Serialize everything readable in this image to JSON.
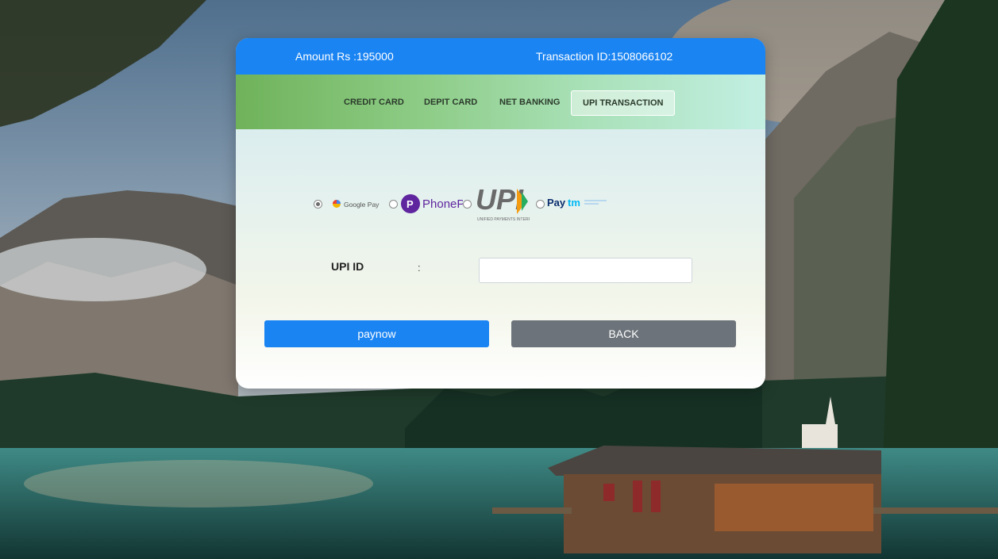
{
  "header": {
    "amount": "Amount Rs :195000",
    "transaction": "Transaction ID:1508066102"
  },
  "tabs": [
    {
      "label": "CREDIT CARD",
      "active": false
    },
    {
      "label": "DEPIT CARD",
      "active": false
    },
    {
      "label": "NET BANKING",
      "active": false
    },
    {
      "label": "UPI TRANSACTION",
      "active": true
    }
  ],
  "payment_options": [
    {
      "name": "Google Pay",
      "icon": "google-pay-logo",
      "selected": true
    },
    {
      "name": "PhonePe",
      "icon": "phonepe-logo",
      "selected": false
    },
    {
      "name": "UPI",
      "icon": "upi-logo",
      "selected": false
    },
    {
      "name": "Paytm",
      "icon": "paytm-logo",
      "selected": false
    }
  ],
  "form": {
    "upi_label": "UPI ID",
    "separator": ":",
    "upi_value": ""
  },
  "buttons": {
    "pay_label": "paynow",
    "back_label": "BACK"
  },
  "colors": {
    "primary": "#1a84f2",
    "secondary": "#6c737a",
    "tab_bar": "#8dcc86"
  }
}
